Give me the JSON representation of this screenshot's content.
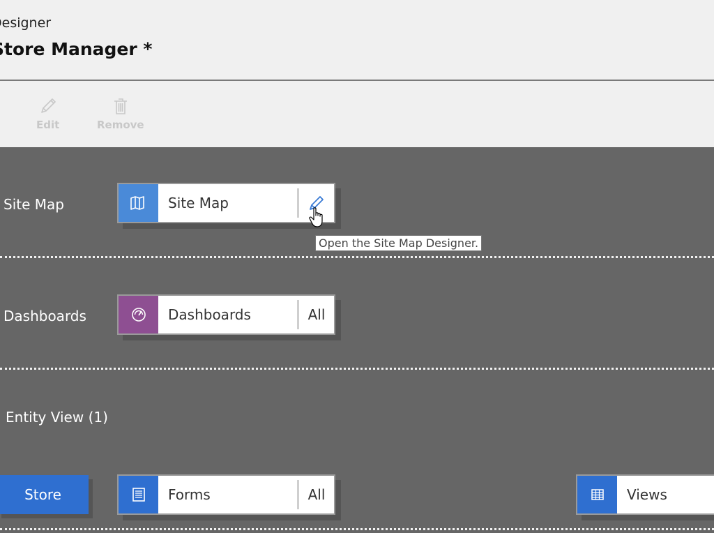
{
  "header": {
    "subtitle": "Designer",
    "title": "Store Manager *"
  },
  "toolbar": {
    "edit_label": "Edit",
    "remove_label": "Remove"
  },
  "rows": {
    "site_map": {
      "label": "Site Map",
      "tile_name": "Site Map",
      "icon": "map-icon",
      "icon_color": "#4a8ad8",
      "action_icon": "pencil-icon"
    },
    "dashboards": {
      "label": "Dashboards",
      "tile_name": "Dashboards",
      "icon": "gauge-icon",
      "icon_color": "#8e4f92",
      "right_label": "All"
    },
    "entity_view": {
      "label": "Entity View (1)",
      "entity_button": "Store",
      "forms": {
        "tile_name": "Forms",
        "icon": "form-icon",
        "icon_color": "#2f6fd0",
        "right_label": "All"
      },
      "views": {
        "tile_name": "Views",
        "icon": "grid-icon",
        "icon_color": "#2f6fd0"
      }
    }
  },
  "tooltip": {
    "text": "Open the Site Map Designer."
  }
}
